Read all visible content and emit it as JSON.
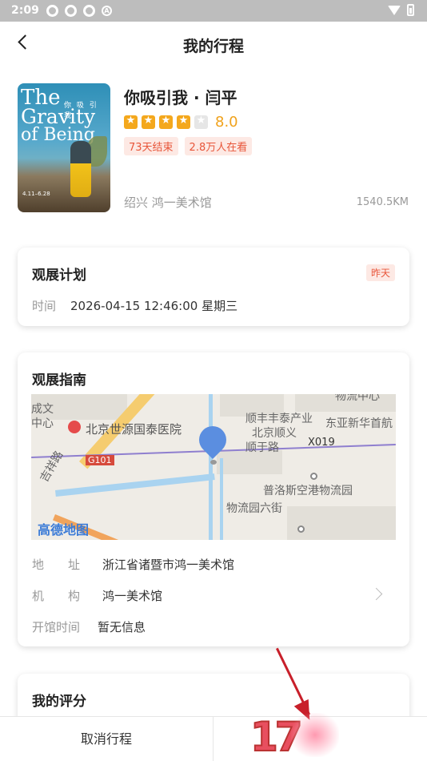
{
  "status_bar": {
    "time": "2:09"
  },
  "nav": {
    "title": "我的行程"
  },
  "exhibition": {
    "title": "你吸引我 · 闫平",
    "rating": "8.0",
    "stars_filled": 4,
    "stars_total": 5,
    "tags": [
      "73天结束",
      "2.8万人在看"
    ],
    "city_venue": "绍兴  鸿一美术馆",
    "distance": "1540.5KM",
    "poster": {
      "line1": "The",
      "line1_cn": "你 吸 引 我",
      "line2": "Gravity",
      "line3": "of Being",
      "dates": "4.11–6.28"
    }
  },
  "plan": {
    "title": "观展计划",
    "badge": "昨天",
    "time_label": "时间",
    "time_value": "2026-04-15 12:46:00  星期三"
  },
  "guide": {
    "title": "观展指南",
    "map": {
      "labels": {
        "hospital": "北京世源国泰医院",
        "shunfeng": "顺丰丰泰产业",
        "beijing_shunyi": "北京顺义",
        "shunyu_road": "顺于路",
        "dongya": "东亚新华首航",
        "puluosi": "普洛斯空港物流园",
        "wuliu": "物流园六街",
        "chengwen": "成文",
        "zhongxin": "中心",
        "jixiang": "吉祥路",
        "wuliu_top": "物流中心",
        "g101": "G101",
        "x019": "X019",
        "amap": "高德地图"
      }
    },
    "address_label": "地　　址",
    "address_value": "浙江省诸暨市鸿一美术馆",
    "org_label": "机　　构",
    "org_value": "鸿一美术馆",
    "hours_label": "开馆时间",
    "hours_value": "暂无信息"
  },
  "my_rating": {
    "title": "我的评分"
  },
  "bottom": {
    "cancel_label": "取消行程",
    "watermark": "17"
  },
  "colors": {
    "accent_orange": "#f4a81d",
    "tag_red": "#e8563a",
    "tag_bg": "#fde9e4",
    "pin_blue": "#5b8ee0"
  }
}
